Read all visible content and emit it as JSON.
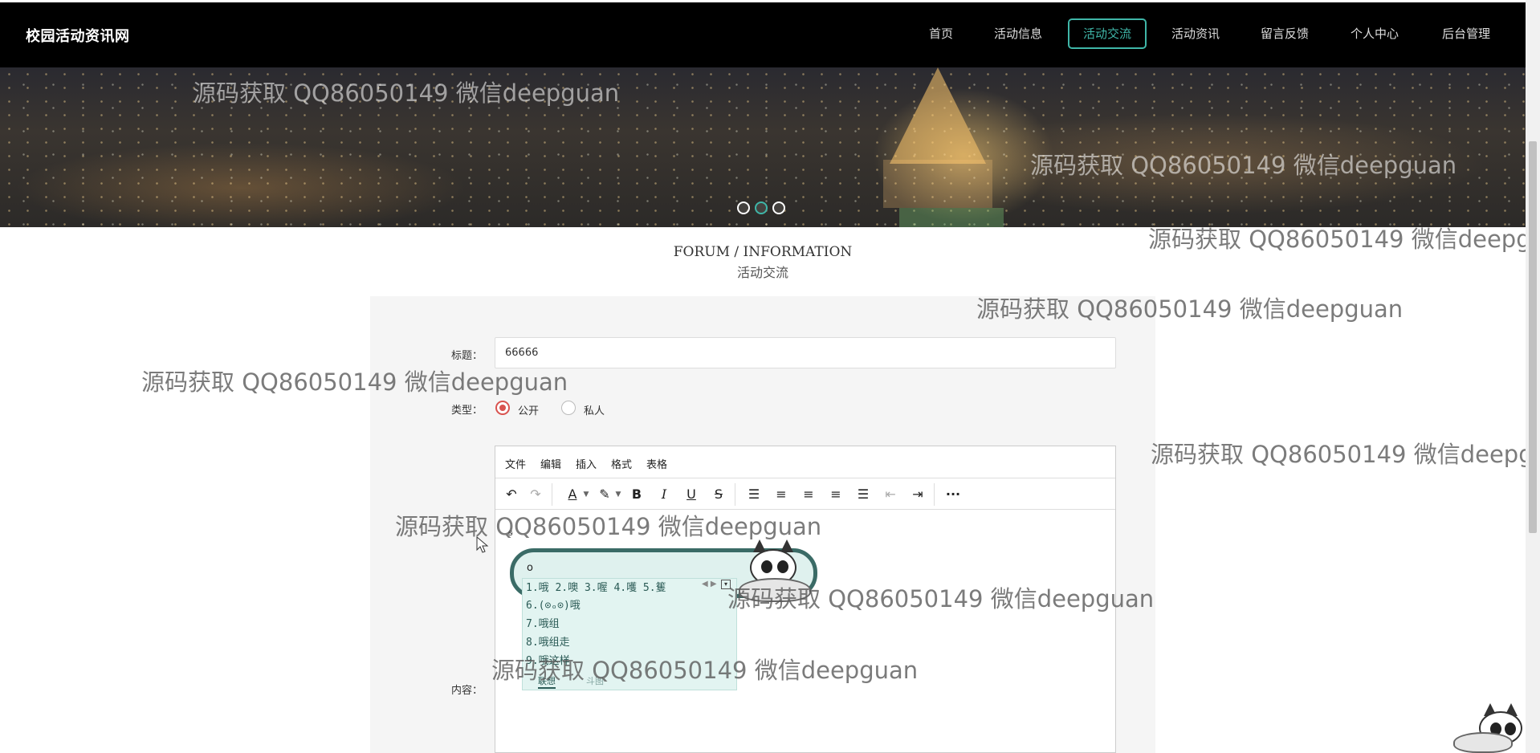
{
  "header": {
    "brand": "校园活动资讯网",
    "nav": [
      {
        "label": "首页"
      },
      {
        "label": "活动信息"
      },
      {
        "label": "活动交流",
        "active": true
      },
      {
        "label": "活动资讯"
      },
      {
        "label": "留言反馈"
      },
      {
        "label": "个人中心"
      },
      {
        "label": "后台管理"
      }
    ]
  },
  "banner": {
    "slides": 3,
    "active_slide": 2
  },
  "section": {
    "title_en": "FORUM / INFORMATION",
    "title_cn": "活动交流"
  },
  "form": {
    "title_label": "标题：",
    "title_value": "66666",
    "type_label": "类型：",
    "type_options": [
      "公开",
      "私人"
    ],
    "type_selected": "公开",
    "content_label": "内容："
  },
  "editor": {
    "menus": [
      "文件",
      "编辑",
      "插入",
      "格式",
      "表格"
    ],
    "toolbar_icons": [
      "undo-icon",
      "redo-icon",
      "font-color-icon",
      "highlight-color-icon",
      "bold-icon",
      "italic-icon",
      "underline-icon",
      "strikethrough-icon",
      "line-height-icon",
      "align-left-icon",
      "align-center-icon",
      "align-right-icon",
      "align-justify-icon",
      "outdent-icon",
      "indent-icon",
      "more-icon"
    ],
    "small_glyph": "ᵴ"
  },
  "ime": {
    "input": "o",
    "first_row": "1.哦 2.噢 3.喔 4.嚄 5.篗",
    "candidates": [
      "6.(⊙ₒ⊙)哦",
      "7.哦组",
      "8.哦组走",
      "9.哦这样"
    ],
    "tabs": [
      "联想",
      "斗图"
    ],
    "active_tab": "联想"
  },
  "watermark_text": "源码获取 QQ86050149 微信deepguan",
  "colors": {
    "accent": "#3fb6a8",
    "navbar": "#000000",
    "radio_checked": "#d9534f",
    "panel": "#f5f5f5"
  }
}
